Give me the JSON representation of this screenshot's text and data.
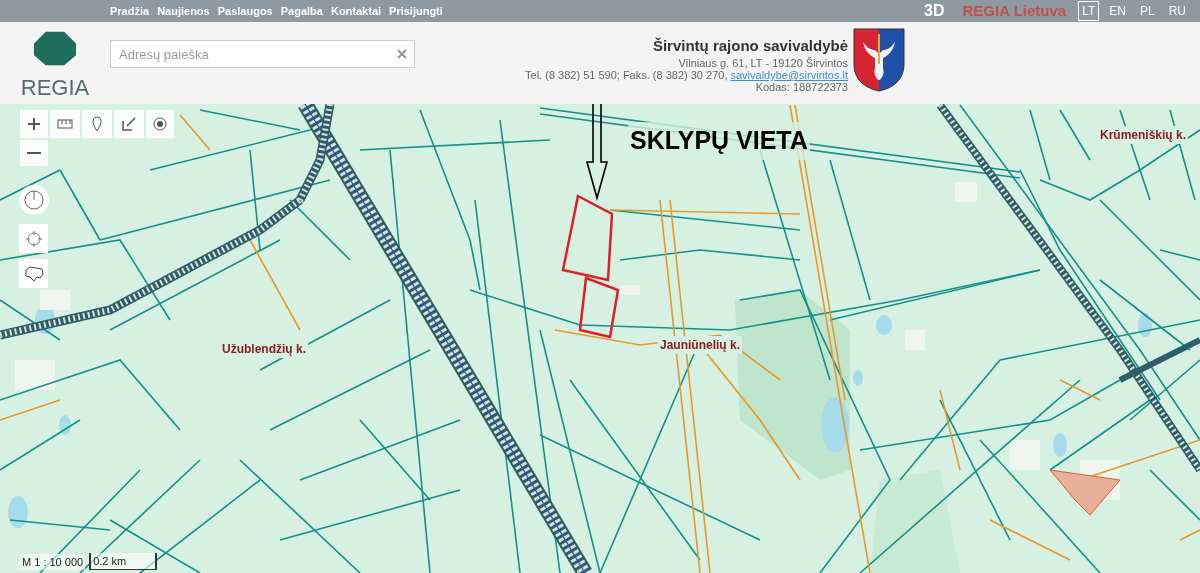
{
  "top_bar": {
    "nav": [
      "Pradžia",
      "Naujienos",
      "Paslaugos",
      "Pagalba",
      "Kontaktai",
      "Prisijungti"
    ],
    "view_3d": "3D",
    "brand": "REGIA Lietuva",
    "languages": [
      {
        "label": "LT",
        "selected": true
      },
      {
        "label": "EN",
        "selected": false
      },
      {
        "label": "PL",
        "selected": false
      },
      {
        "label": "RU",
        "selected": false
      }
    ]
  },
  "header": {
    "logo_text": "REGIA",
    "search": {
      "placeholder": "Adresų paieška"
    },
    "municipality": {
      "name": "Širvintų rajono savivaldybė",
      "address": "Vilniaus g. 61, LT - 19120 Širvintos",
      "phone": "Tel. (8 382) 51 590; Faks. (8 382) 30 270,",
      "email": "savivaldybe@sirvintos.lt",
      "code": "Kodas: 188722373"
    }
  },
  "map": {
    "annotation": "SKLYPŲ VIETA",
    "villages": [
      "Užublendžių k.",
      "Jauniūnelių k.",
      "Krūmeniškių k."
    ],
    "scale": "M 1 : 10 000",
    "scale_bar": "0.2 km"
  }
}
